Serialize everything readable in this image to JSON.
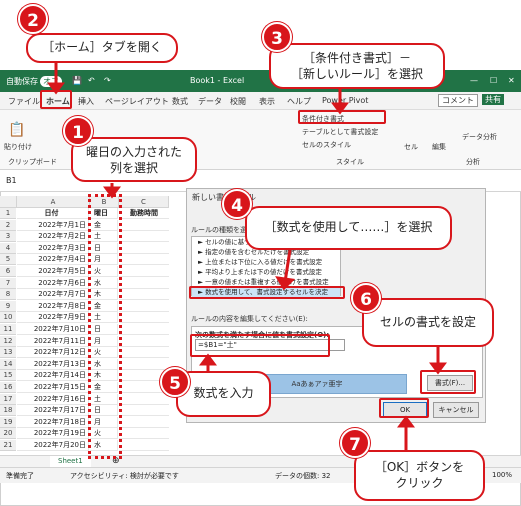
{
  "window": {
    "autosave_label": "自動保存",
    "autosave_state": "オフ",
    "title": "Book1 - Excel"
  },
  "menu": [
    "ファイル",
    "ホーム",
    "挿入",
    "ページレイアウト",
    "数式",
    "データ",
    "校閲",
    "表示",
    "ヘルプ",
    "Power Pivot"
  ],
  "share": {
    "comment": "コメント",
    "share": "共有"
  },
  "ribbon": {
    "paste": "貼り付け",
    "clipboard": "クリップボード",
    "font": "フォント",
    "conditional": "条件付き書式",
    "table": "テーブルとして書式設定",
    "cellstyle": "セルのスタイル",
    "style": "スタイル",
    "cells": "セル",
    "editing": "編集",
    "analysis": "データ分析",
    "analysis2": "分析"
  },
  "namebox": "B1",
  "columns": [
    "A",
    "B",
    "C"
  ],
  "headers": {
    "a": "日付",
    "b": "曜日",
    "c": "勤務時間"
  },
  "rows": [
    {
      "n": "1"
    },
    {
      "n": "2",
      "a": "2022年7月1日",
      "b": "金"
    },
    {
      "n": "3",
      "a": "2022年7月2日",
      "b": "土"
    },
    {
      "n": "4",
      "a": "2022年7月3日",
      "b": "日"
    },
    {
      "n": "5",
      "a": "2022年7月4日",
      "b": "月"
    },
    {
      "n": "6",
      "a": "2022年7月5日",
      "b": "火"
    },
    {
      "n": "7",
      "a": "2022年7月6日",
      "b": "水"
    },
    {
      "n": "8",
      "a": "2022年7月7日",
      "b": "木"
    },
    {
      "n": "9",
      "a": "2022年7月8日",
      "b": "金"
    },
    {
      "n": "10",
      "a": "2022年7月9日",
      "b": "土"
    },
    {
      "n": "11",
      "a": "2022年7月10日",
      "b": "日"
    },
    {
      "n": "12",
      "a": "2022年7月11日",
      "b": "月"
    },
    {
      "n": "13",
      "a": "2022年7月12日",
      "b": "火"
    },
    {
      "n": "14",
      "a": "2022年7月13日",
      "b": "水"
    },
    {
      "n": "15",
      "a": "2022年7月14日",
      "b": "木"
    },
    {
      "n": "16",
      "a": "2022年7月15日",
      "b": "金"
    },
    {
      "n": "17",
      "a": "2022年7月16日",
      "b": "土"
    },
    {
      "n": "18",
      "a": "2022年7月17日",
      "b": "日"
    },
    {
      "n": "19",
      "a": "2022年7月18日",
      "b": "月"
    },
    {
      "n": "20",
      "a": "2022年7月19日",
      "b": "火"
    },
    {
      "n": "21",
      "a": "2022年7月20日",
      "b": "水"
    }
  ],
  "sheet_tab": "Sheet1",
  "status": {
    "ready": "準備完了",
    "accessibility": "アクセシビリティ: 検討が必要です",
    "count": "データの個数: 32",
    "zoom": "100%"
  },
  "dialog": {
    "title": "新しい書式ルール",
    "rule_type_label": "ルールの種類を選択してください(S):",
    "rules": [
      "► セルの値に基づいてすべてのセルを書式設定",
      "► 指定の値を含むセルだけを書式設定",
      "► 上位または下位に入る値だけを書式設定",
      "► 平均より上または下の値だけを書式設定",
      "► 一意の値または重複する値だけを書式設定",
      "► 数式を使用して、書式設定するセルを決定"
    ],
    "edit_label": "ルールの内容を編集してください(E):",
    "formula_label": "次の数式を満たす場合に値を書式設定(O):",
    "formula": "=$B1=\"土\"",
    "preview_text": "Aaあぁアァ亜宇",
    "format_btn": "書式(F)...",
    "ok": "OK",
    "cancel": "キャンセル"
  },
  "callouts": {
    "c1": "曜日の入力された\n列を選択",
    "c2": "［ホーム］タブを開く",
    "c3": "［条件付き書式］－\n［新しいルール］を選択",
    "c4": "［数式を使用して……］を選択",
    "c5": "数式を入力",
    "c6": "セルの書式を設定",
    "c7": "［OK］ボタンを\nクリック"
  },
  "badges": [
    "1",
    "2",
    "3",
    "4",
    "5",
    "6",
    "7"
  ]
}
